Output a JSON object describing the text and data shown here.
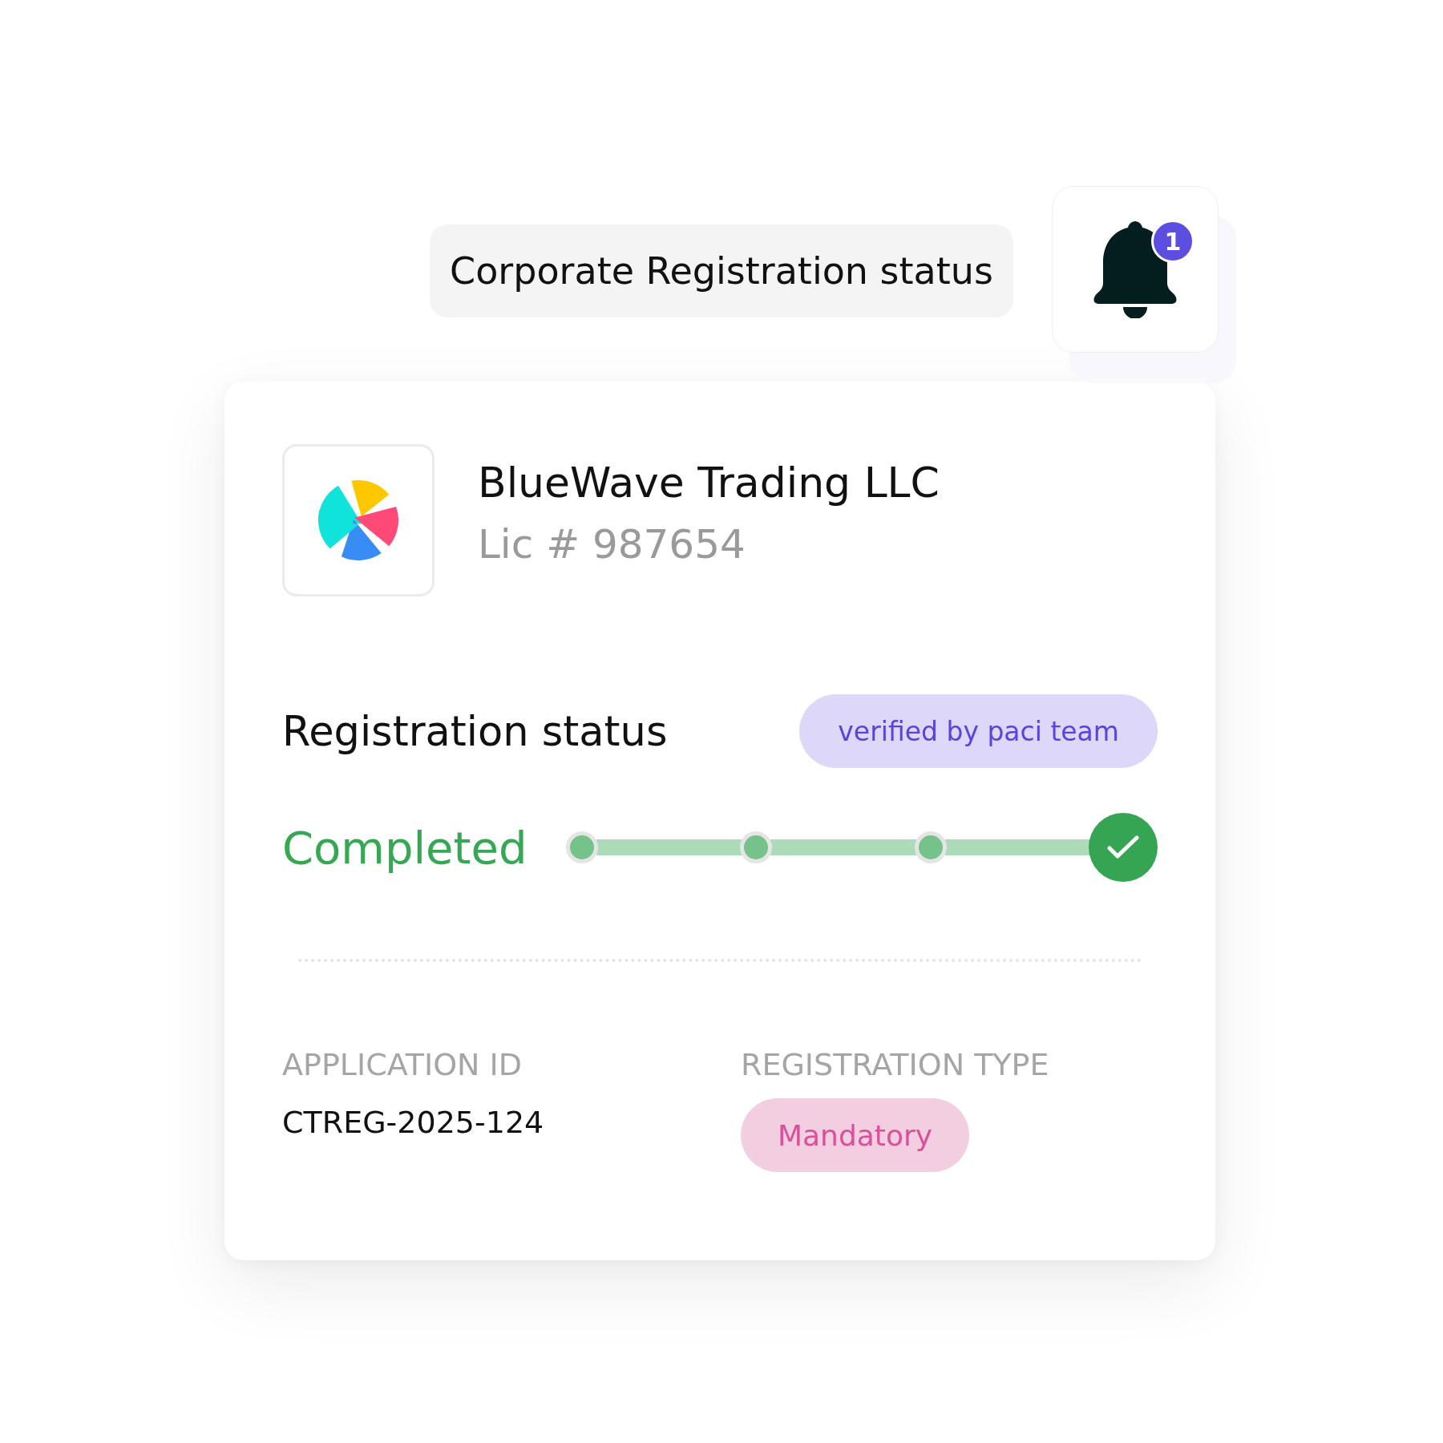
{
  "header": {
    "title": "Corporate Registration status",
    "notifications": {
      "count": "1"
    }
  },
  "company": {
    "name": "BlueWave Trading LLC",
    "license": "Lic # 987654"
  },
  "registration": {
    "heading": "Registration status",
    "badge": "verified by paci team",
    "status": "Completed",
    "level": 1,
    "steps": [
      {
        "kind": "dot",
        "done": true
      },
      {
        "kind": "dot",
        "done": true
      },
      {
        "kind": "dot",
        "done": true
      },
      {
        "kind": "check",
        "done": true
      }
    ]
  },
  "details": [
    {
      "label": "APPLICATION ID",
      "kind": "text",
      "value": "CTREG-2025-124"
    },
    {
      "label": "REGISTRATION TYPE",
      "kind": "tag",
      "value": "Mandatory"
    }
  ]
}
